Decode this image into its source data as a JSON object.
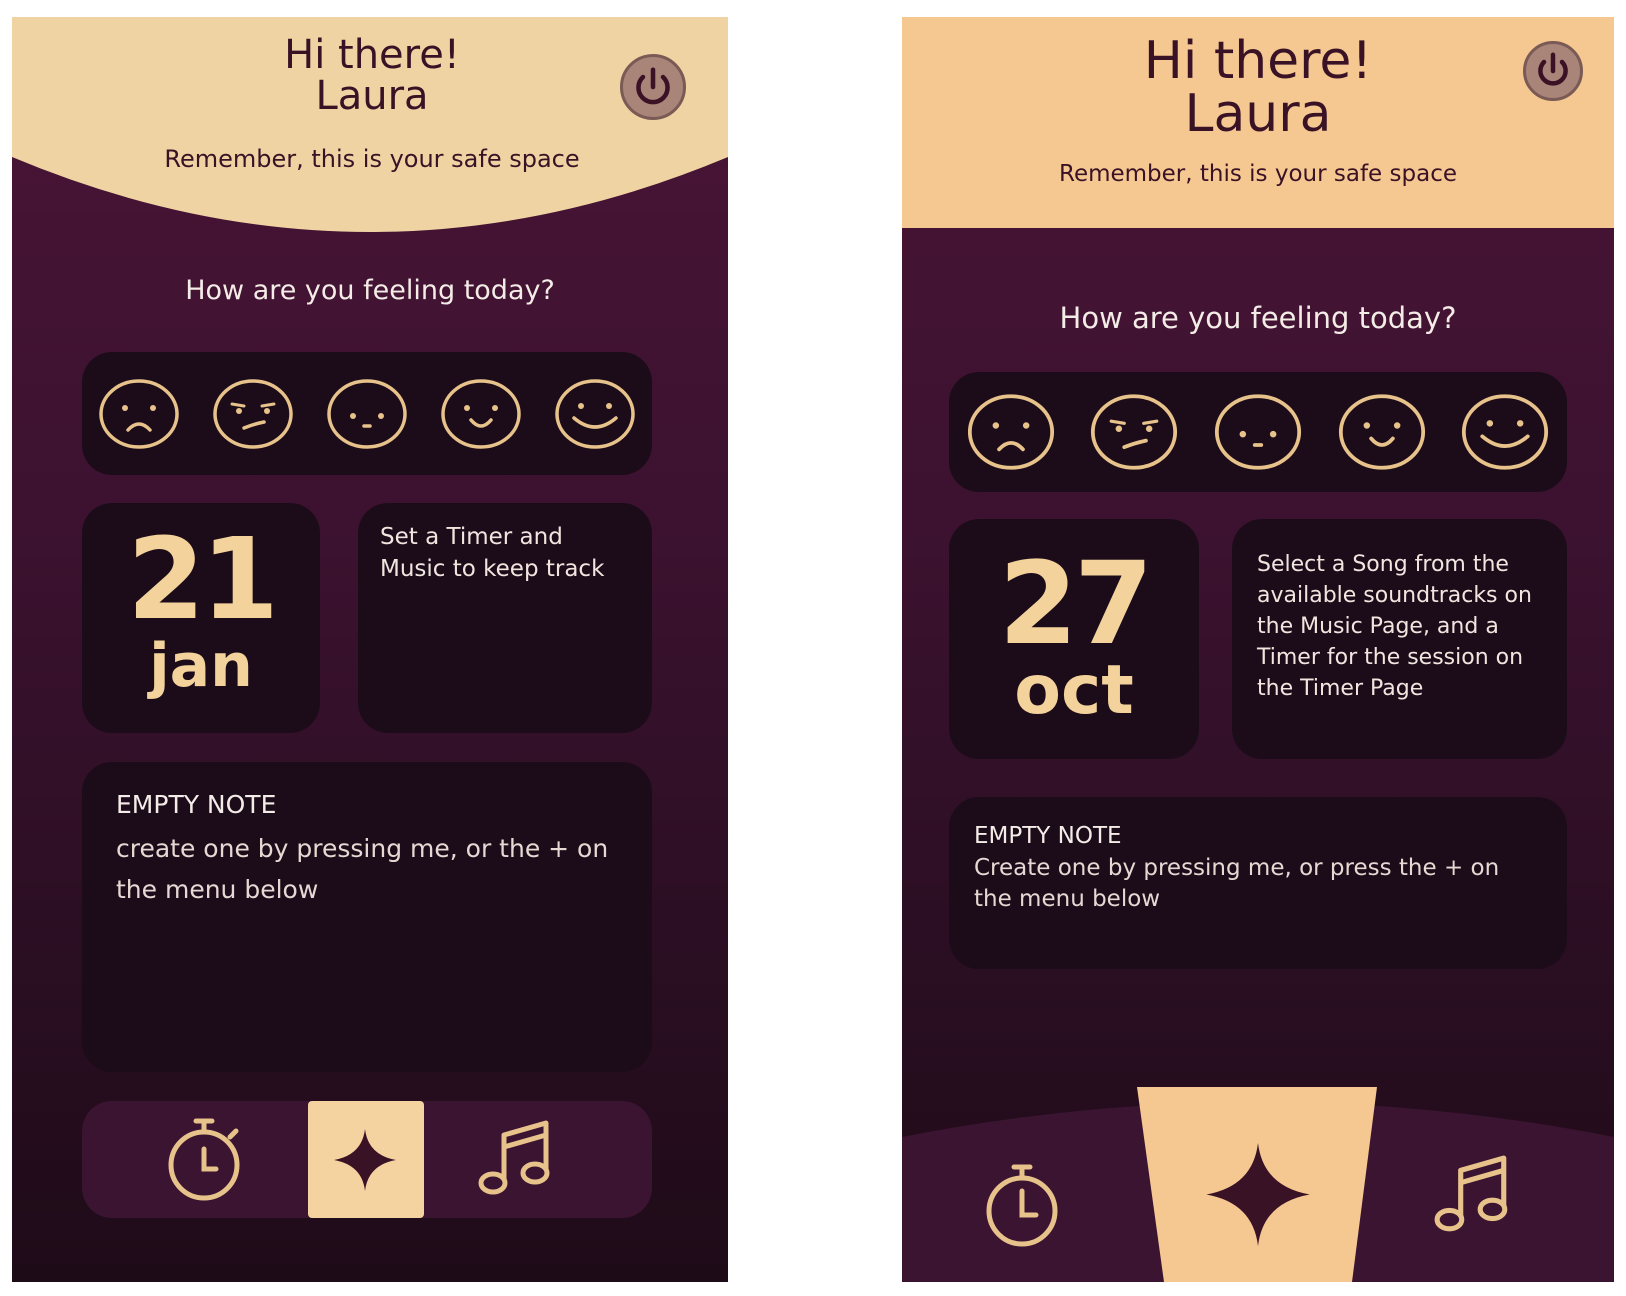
{
  "screen_a": {
    "greeting": "Hi there!",
    "user_name": "Laura",
    "subtitle": "Remember, this is your safe space",
    "question": "How are you feeling today?",
    "moods": [
      "very-sad-face-icon",
      "unsure-face-icon",
      "neutral-face-icon",
      "happy-face-icon",
      "very-happy-face-icon"
    ],
    "date": {
      "day": "21",
      "month": "jan"
    },
    "tip": "Set a Timer and Music to keep track",
    "note": {
      "title": "EMPTY NOTE",
      "body": "create one by pressing me, or the + on the menu below"
    },
    "nav": {
      "items": [
        "stopwatch-icon",
        "sparkle-icon",
        "music-note-icon"
      ],
      "active": "sparkle-icon"
    }
  },
  "screen_b": {
    "greeting": "Hi there!",
    "user_name": "Laura",
    "subtitle": "Remember, this is your safe space",
    "question": "How are you feeling today?",
    "moods": [
      "very-sad-face-icon",
      "unsure-face-icon",
      "neutral-face-icon",
      "happy-face-icon",
      "very-happy-face-icon"
    ],
    "date": {
      "day": "27",
      "month": "oct"
    },
    "tip": "Select a Song from the available soundtracks on the Music Page, and a Timer for the session on the Timer Page",
    "note": {
      "title": "EMPTY NOTE",
      "body": "Create one by pressing me, or press the + on the menu below"
    },
    "nav": {
      "items": [
        "stopwatch-icon",
        "sparkle-icon",
        "music-note-icon"
      ],
      "active": "sparkle-icon"
    }
  },
  "colors": {
    "header_bg_a": "#f0d3a3",
    "header_bg_b": "#f5c891",
    "bg_top": "#4a1436",
    "bg_bottom": "#1e0b18",
    "panel": "#1c0c1a",
    "accent": "#f3d39b",
    "text_dark": "#3a1226",
    "text_light": "#f4ece6",
    "power": "#a98478"
  }
}
